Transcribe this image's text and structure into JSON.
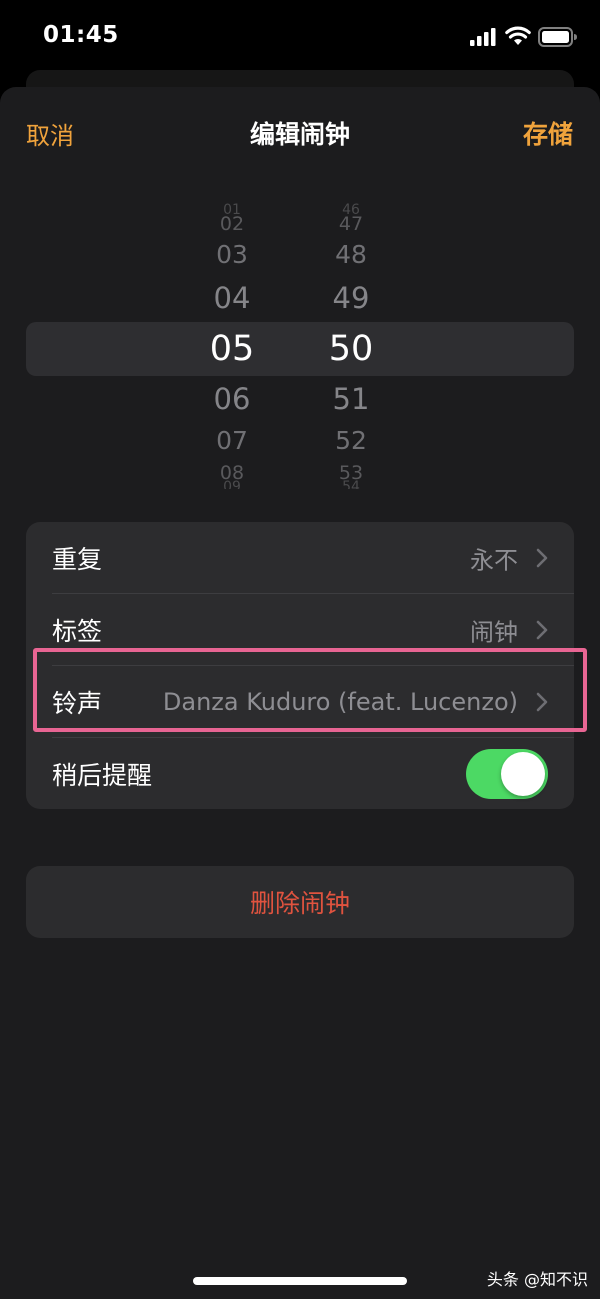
{
  "status_bar": {
    "time": "01:45"
  },
  "nav": {
    "cancel": "取消",
    "title": "编辑闹钟",
    "save": "存储"
  },
  "picker": {
    "hour": {
      "selected": "05",
      "above": [
        "01",
        "02",
        "03",
        "04"
      ],
      "below": [
        "06",
        "07",
        "08",
        "09"
      ]
    },
    "minute": {
      "selected": "50",
      "above": [
        "46",
        "47",
        "48",
        "49"
      ],
      "below": [
        "51",
        "52",
        "53",
        "54"
      ]
    }
  },
  "settings": {
    "repeat": {
      "label": "重复",
      "value": "永不"
    },
    "label": {
      "label": "标签",
      "value": "闹钟"
    },
    "sound": {
      "label": "铃声",
      "value": "Danza Kuduro (feat. Lucenzo)"
    },
    "snooze": {
      "label": "稍后提醒",
      "enabled": true
    }
  },
  "delete_button": "删除闹钟",
  "watermark": "头条 @知不识",
  "colors": {
    "accent": "#f0a33c",
    "destructive": "#e0533f",
    "toggle_on": "#4cd964",
    "annotation": "#e86593"
  }
}
